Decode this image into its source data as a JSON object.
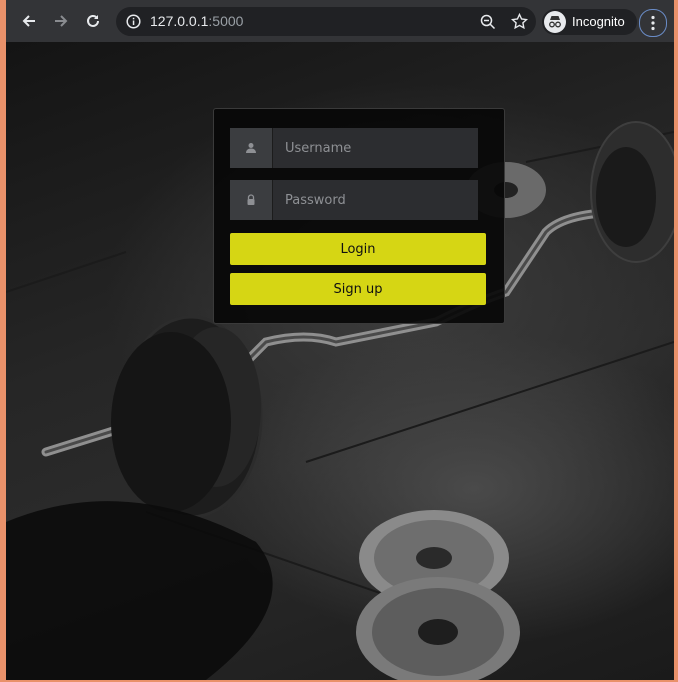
{
  "browser": {
    "url_host": "127.0.0.1",
    "url_port": ":5000",
    "incognito_label": "Incognito"
  },
  "login": {
    "username_placeholder": "Username",
    "password_placeholder": "Password",
    "login_label": "Login",
    "signup_label": "Sign up"
  },
  "colors": {
    "accent": "#d6d614",
    "panel": "#080808",
    "frame": "#e9916a"
  }
}
